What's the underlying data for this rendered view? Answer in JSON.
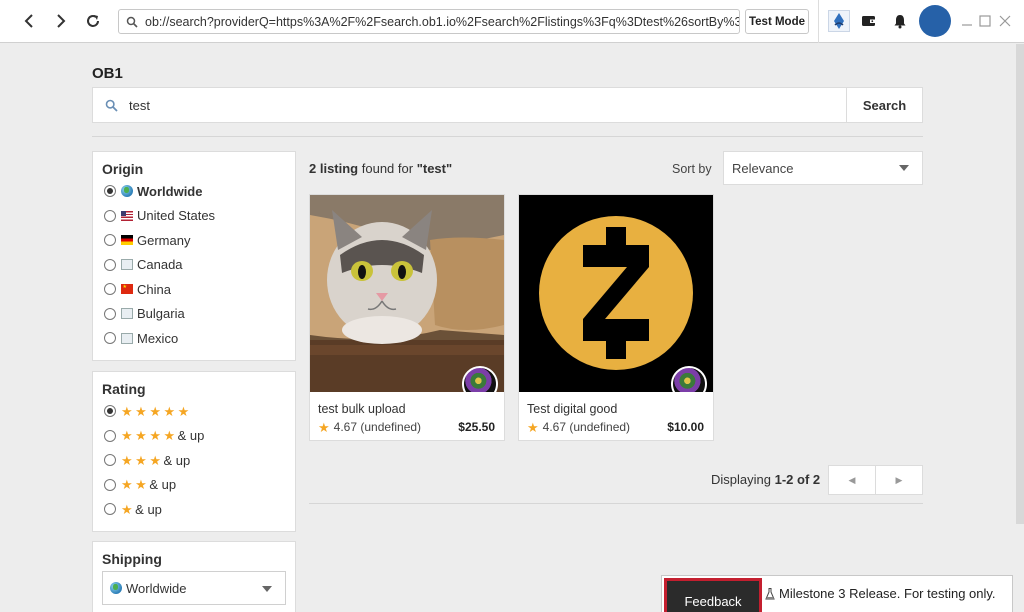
{
  "browser": {
    "url": "ob://search?providerQ=https%3A%2F%2Fsearch.ob1.io%2Fsearch%2Flistings%3Fq%3Dtest%26sortBy%3",
    "test_mode_label": "Test Mode"
  },
  "search": {
    "provider_name": "OB1",
    "query": "test",
    "button_label": "Search"
  },
  "filters": {
    "origin": {
      "title": "Origin",
      "options": [
        {
          "label": "Worldwide",
          "selected": true,
          "flag": "globe"
        },
        {
          "label": "United States",
          "selected": false,
          "flag": "us-flag"
        },
        {
          "label": "Germany",
          "selected": false,
          "flag": "de-flag"
        },
        {
          "label": "Canada",
          "selected": false,
          "flag": "placeholder-flag"
        },
        {
          "label": "China",
          "selected": false,
          "flag": "cn-flag"
        },
        {
          "label": "Bulgaria",
          "selected": false,
          "flag": "placeholder-flag"
        },
        {
          "label": "Mexico",
          "selected": false,
          "flag": "placeholder-flag"
        }
      ]
    },
    "rating": {
      "title": "Rating",
      "options": [
        {
          "stars": 5,
          "suffix": "",
          "selected": true
        },
        {
          "stars": 4,
          "suffix": "& up",
          "selected": false
        },
        {
          "stars": 3,
          "suffix": "& up",
          "selected": false
        },
        {
          "stars": 2,
          "suffix": "& up",
          "selected": false
        },
        {
          "stars": 1,
          "suffix": "& up",
          "selected": false
        }
      ]
    },
    "shipping": {
      "title": "Shipping",
      "selected": "Worldwide"
    }
  },
  "results": {
    "count": "2 listing",
    "found_for": "found for",
    "query_quoted": "\"test\"",
    "sort_label": "Sort by",
    "sort_value": "Relevance",
    "listings": [
      {
        "title": "test bulk upload",
        "rating": "4.67 (undefined)",
        "price": "$25.50",
        "image": "cat-in-paper-roll"
      },
      {
        "title": "Test digital good",
        "rating": "4.67 (undefined)",
        "price": "$10.00",
        "image": "zcash-logo"
      }
    ],
    "displaying_prefix": "Displaying",
    "displaying_range": "1-2 of 2"
  },
  "footer": {
    "feedback_label": "Feedback",
    "milestone_text": "Milestone 3 Release. For testing only."
  },
  "colors": {
    "accent_star": "#f5a623",
    "feedback_border": "#c41f2f",
    "avatar": "#2661a8"
  }
}
